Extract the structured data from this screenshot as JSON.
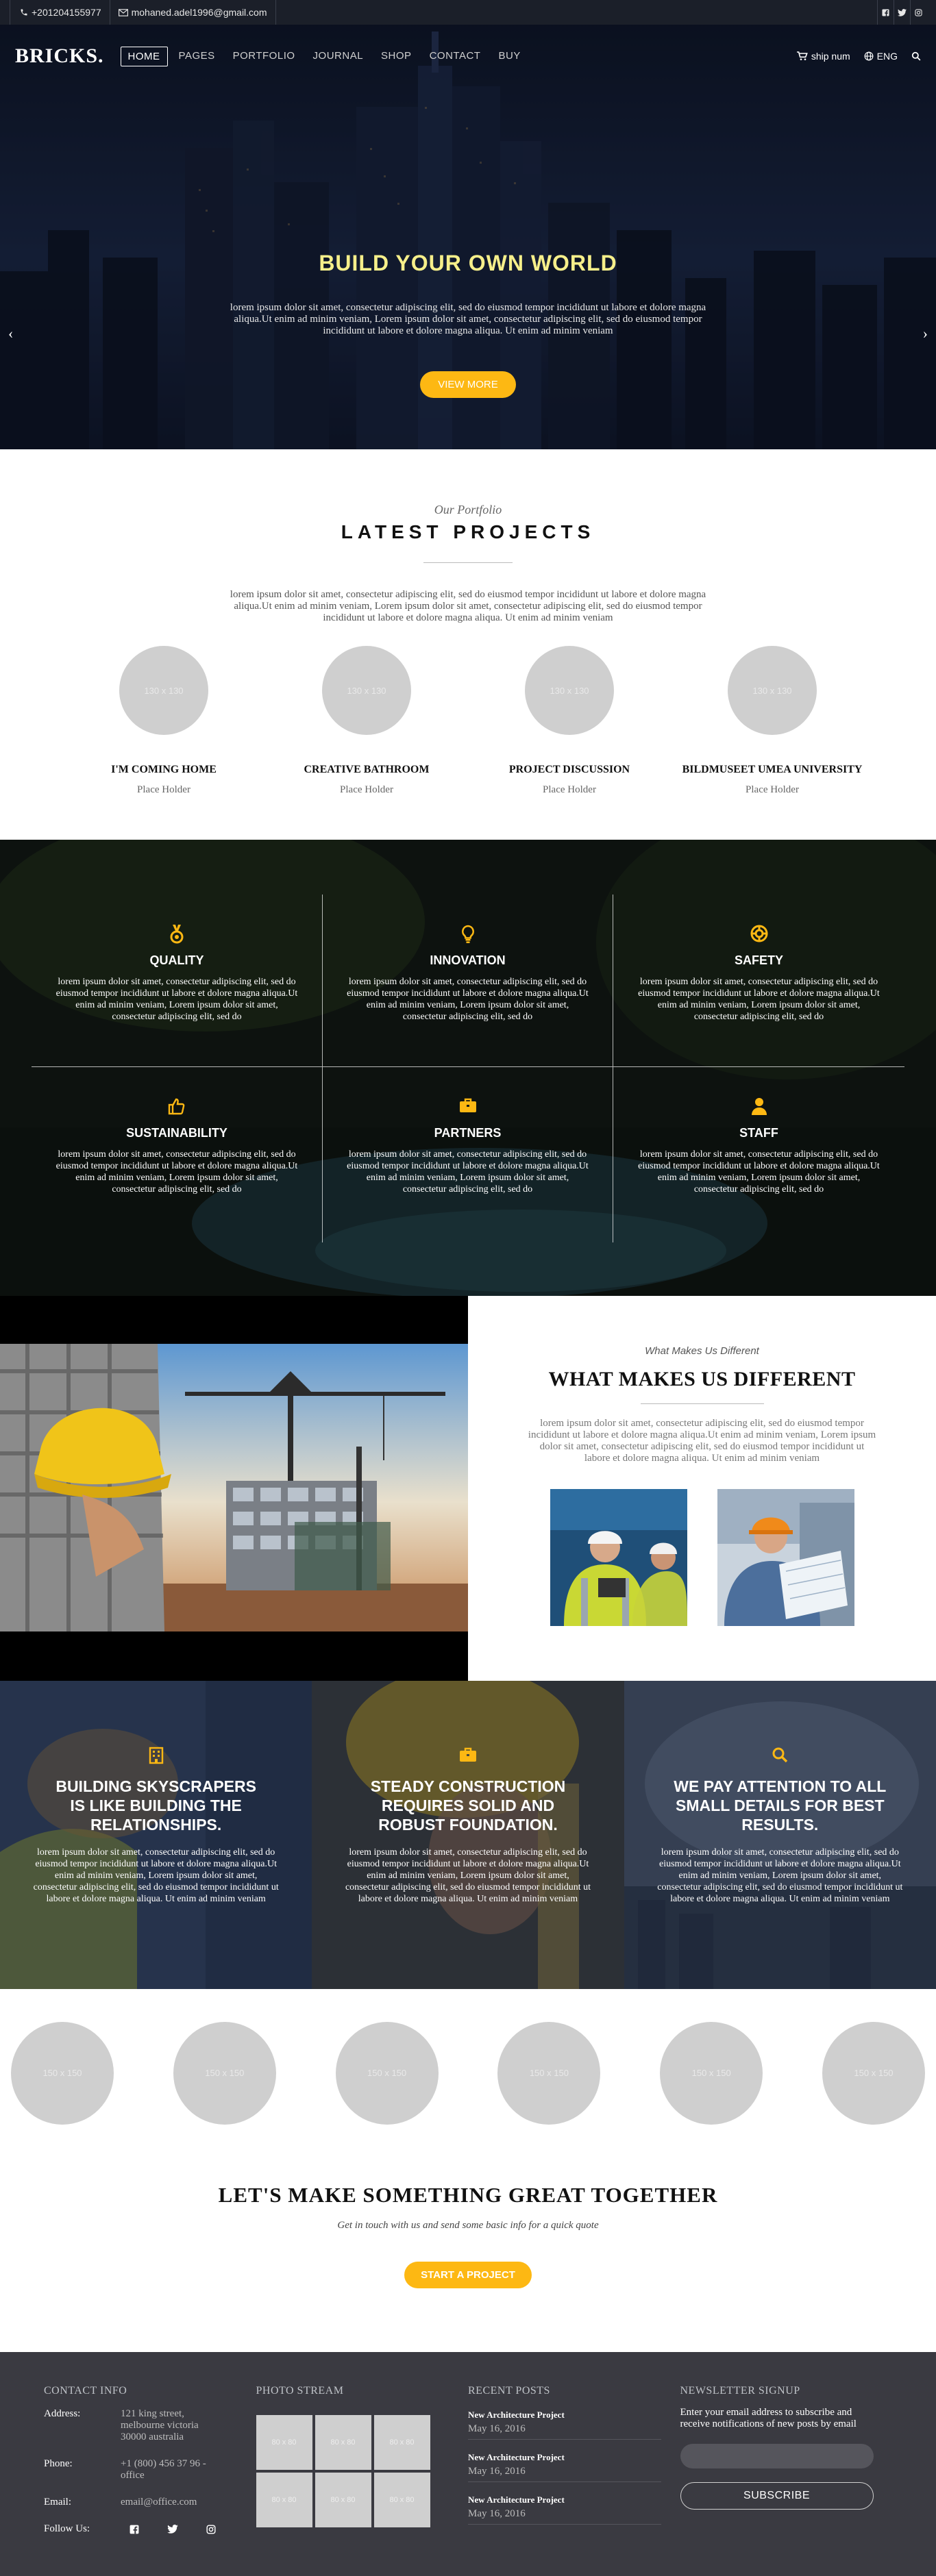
{
  "topbar": {
    "phone": "+201204155977",
    "email": "mohaned.adel1996@gmail.com",
    "social_icons": [
      "facebook-icon",
      "twitter-icon",
      "instagram-icon"
    ]
  },
  "nav": {
    "logo": "BRICKS.",
    "items": [
      "HOME",
      "PAGES",
      "PORTFOLIO",
      "JOURNAL",
      "SHOP",
      "CONTACT",
      "BUY"
    ],
    "active": "HOME",
    "cart_label": "ship num",
    "lang_label": "ENG"
  },
  "hero": {
    "title": "BUILD YOUR OWN WORLD",
    "text": "lorem ipsum dolor sit amet, consectetur adipiscing elit, sed do eiusmod tempor incididunt ut labore et dolore magna aliqua.Ut enim ad minim veniam, Lorem ipsum dolor sit amet, consectetur adipiscing elit, sed do eiusmod tempor incididunt ut labore et dolore magna aliqua. Ut enim ad minim veniam",
    "button": "VIEW MORE",
    "prev_arrow": "‹",
    "next_arrow": "›"
  },
  "portfolio": {
    "eyebrow": "Our Portfolio",
    "title": "LATEST PROJECTS",
    "lead": "lorem ipsum dolor sit amet, consectetur adipiscing elit, sed do eiusmod tempor incididunt ut labore et dolore magna aliqua.Ut enim ad minim veniam, Lorem ipsum dolor sit amet, consectetur adipiscing elit, sed do eiusmod tempor incididunt ut labore et dolore magna aliqua. Ut enim ad minim veniam",
    "projects": [
      {
        "placeholder": "130 x 130",
        "title": "I'M COMING HOME",
        "sub": "Place Holder"
      },
      {
        "placeholder": "130 x 130",
        "title": "CREATIVE BATHROOM",
        "sub": "Place Holder"
      },
      {
        "placeholder": "130 x 130",
        "title": "PROJECT DISCUSSION",
        "sub": "Place Holder"
      },
      {
        "placeholder": "130 x 130",
        "title": "BILDMUSEET UMEA UNIVERSITY",
        "sub": "Place Holder"
      }
    ]
  },
  "features": {
    "accent": "#fdb813",
    "items": [
      {
        "icon": "medal-icon",
        "title": "QUALITY",
        "text": "lorem ipsum dolor sit amet, consectetur adipiscing elit, sed do eiusmod tempor incididunt ut labore et dolore magna aliqua.Ut enim ad minim veniam, Lorem ipsum dolor sit amet, consectetur adipiscing elit, sed do"
      },
      {
        "icon": "lightbulb-icon",
        "title": "INNOVATION",
        "text": "lorem ipsum dolor sit amet, consectetur adipiscing elit, sed do eiusmod tempor incididunt ut labore et dolore magna aliqua.Ut enim ad minim veniam, Lorem ipsum dolor sit amet, consectetur adipiscing elit, sed do"
      },
      {
        "icon": "lifebuoy-icon",
        "title": "SAFETY",
        "text": "lorem ipsum dolor sit amet, consectetur adipiscing elit, sed do eiusmod tempor incididunt ut labore et dolore magna aliqua.Ut enim ad minim veniam, Lorem ipsum dolor sit amet, consectetur adipiscing elit, sed do"
      },
      {
        "icon": "thumbs-up-icon",
        "title": "SUSTAINABILITY",
        "text": "lorem ipsum dolor sit amet, consectetur adipiscing elit, sed do eiusmod tempor incididunt ut labore et dolore magna aliqua.Ut enim ad minim veniam, Lorem ipsum dolor sit amet, consectetur adipiscing elit, sed do"
      },
      {
        "icon": "briefcase-icon",
        "title": "PARTNERS",
        "text": "lorem ipsum dolor sit amet, consectetur adipiscing elit, sed do eiusmod tempor incididunt ut labore et dolore magna aliqua.Ut enim ad minim veniam, Lorem ipsum dolor sit amet, consectetur adipiscing elit, sed do"
      },
      {
        "icon": "user-icon",
        "title": "STAFF",
        "text": "lorem ipsum dolor sit amet, consectetur adipiscing elit, sed do eiusmod tempor incididunt ut labore et dolore magna aliqua.Ut enim ad minim veniam, Lorem ipsum dolor sit amet, consectetur adipiscing elit, sed do"
      }
    ]
  },
  "different": {
    "eyebrow": "What Makes Us Different",
    "title": "WHAT MAKES US DIFFERENT",
    "lead": "lorem ipsum dolor sit amet, consectetur adipiscing elit, sed do eiusmod tempor incididunt ut labore et dolore magna aliqua.Ut enim ad minim veniam, Lorem ipsum dolor sit amet, consectetur adipiscing elit, sed do eiusmod tempor incididunt ut labore et dolore magna aliqua. Ut enim ad minim veniam"
  },
  "columns": [
    {
      "icon": "building-icon",
      "title": "BUILDING SKYSCRAPERS IS LIKE BUILDING THE RELATIONSHIPS.",
      "text": "lorem ipsum dolor sit amet, consectetur adipiscing elit, sed do eiusmod tempor incididunt ut labore et dolore magna aliqua.Ut enim ad minim veniam, Lorem ipsum dolor sit amet, consectetur adipiscing elit, sed do eiusmod tempor incididunt ut labore et dolore magna aliqua. Ut enim ad minim veniam"
    },
    {
      "icon": "briefcase-icon",
      "title": "STEADY CONSTRUCTION REQUIRES SOLID AND ROBUST FOUNDATION.",
      "text": "lorem ipsum dolor sit amet, consectetur adipiscing elit, sed do eiusmod tempor incididunt ut labore et dolore magna aliqua.Ut enim ad minim veniam, Lorem ipsum dolor sit amet, consectetur adipiscing elit, sed do eiusmod tempor incididunt ut labore et dolore magna aliqua. Ut enim ad minim veniam"
    },
    {
      "icon": "search-icon",
      "title": "WE PAY ATTENTION TO ALL SMALL DETAILS FOR BEST RESULTS.",
      "text": "lorem ipsum dolor sit amet, consectetur adipiscing elit, sed do eiusmod tempor incididunt ut labore et dolore magna aliqua.Ut enim ad minim veniam, Lorem ipsum dolor sit amet, consectetur adipiscing elit, sed do eiusmod tempor incididunt ut labore et dolore magna aliqua. Ut enim ad minim veniam"
    }
  ],
  "clients": [
    "150 x 150",
    "150 x 150",
    "150 x 150",
    "150 x 150",
    "150 x 150",
    "150 x 150"
  ],
  "cta": {
    "title": "LET'S MAKE SOMETHING GREAT TOGETHER",
    "subtitle": "Get in touch with us and send some basic info for a quick quote",
    "button": "START A PROJECT"
  },
  "footer": {
    "contact": {
      "heading": "CONTACT INFO",
      "address_label": "Address:",
      "address": "121 king street, melbourne victoria 30000 australia",
      "phone_label": "Phone:",
      "phone": "+1 (800) 456 37 96 - office",
      "email_label": "Email:",
      "email": "email@office.com",
      "follow_label": "Follow Us:"
    },
    "stream": {
      "heading": "PHOTO STREAM",
      "items": [
        "80 x 80",
        "80 x 80",
        "80 x 80",
        "80 x 80",
        "80 x 80",
        "80 x 80"
      ]
    },
    "posts": {
      "heading": "RECENT POSTS",
      "items": [
        {
          "title": "New Architecture Project",
          "date": "May 16, 2016"
        },
        {
          "title": "New Architecture Project",
          "date": "May 16, 2016"
        },
        {
          "title": "New Architecture Project",
          "date": "May 16, 2016"
        }
      ]
    },
    "newsletter": {
      "heading": "NEWSLETTER SIGNUP",
      "text": "Enter your email address to subscribe and receive notifications of new posts by email",
      "placeholder": "",
      "button": "SUBSCRIBE"
    }
  }
}
